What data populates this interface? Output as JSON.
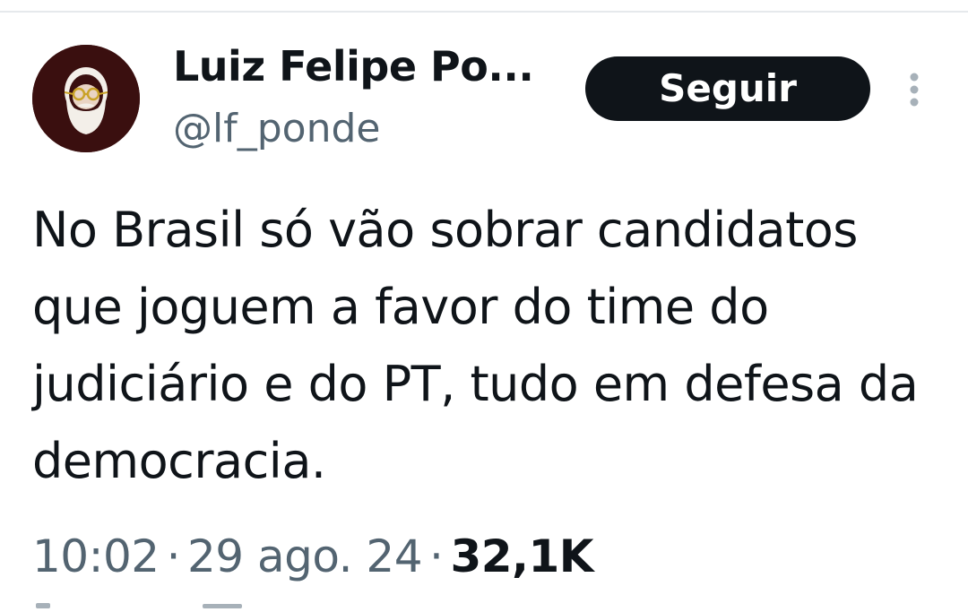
{
  "tweet": {
    "author": {
      "display_name": "Luiz Felipe Po...",
      "handle": "@lf_ponde",
      "avatar_icon": "bearded-man-with-glasses-avatar"
    },
    "follow_label": "Seguir",
    "more_icon": "vertical-ellipsis-icon",
    "text": "No Brasil só vão sobrar candidatos que joguem a favor do time do judiciário e do PT, tudo em defesa da democracia.",
    "time": "10:02",
    "separator": "·",
    "date": "29 ago. 24",
    "views": "32,1K"
  },
  "colors": {
    "text_primary": "#0f1419",
    "text_secondary": "#536471",
    "button_background": "#0f1419",
    "button_text": "#ffffff",
    "avatar_background": "#3a0f0f"
  }
}
